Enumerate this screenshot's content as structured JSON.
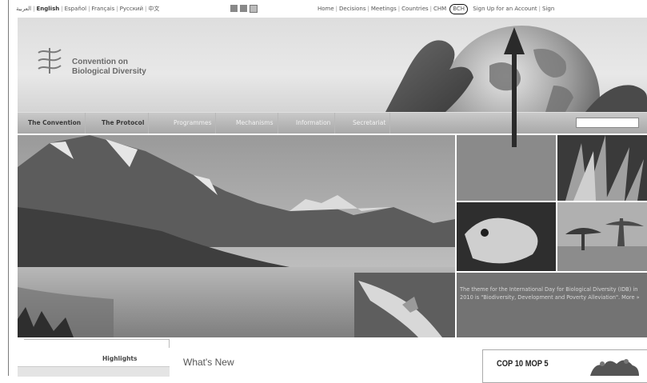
{
  "top_bar": {
    "languages": [
      {
        "label": "العربية",
        "bold": false
      },
      {
        "label": "English",
        "bold": true
      },
      {
        "label": "Español",
        "bold": false
      },
      {
        "label": "Français",
        "bold": false
      },
      {
        "label": "Русский",
        "bold": false
      },
      {
        "label": "中文",
        "bold": false
      }
    ],
    "icons": [
      "print-icon",
      "bookmark-icon",
      "rss-icon"
    ],
    "links": [
      "Home",
      "Decisions",
      "Meetings",
      "Countries",
      "CHM",
      "BCH",
      "Sign Up for an Account",
      "Sign"
    ],
    "highlighted_link": "BCH"
  },
  "logo": {
    "line1": "Convention on",
    "line2": "Biological Diversity"
  },
  "nav": {
    "items": [
      {
        "label": "The Convention",
        "strong": true
      },
      {
        "label": "The Protocol",
        "strong": true
      },
      {
        "label": "Programmes",
        "strong": false
      },
      {
        "label": "Mechanisms",
        "strong": false
      },
      {
        "label": "Information",
        "strong": false
      },
      {
        "label": "Secretariat",
        "strong": false
      }
    ],
    "search_value": ""
  },
  "hero": {
    "theme_text": "The theme for the International Day for Biological Diversity (IDB) in 2010 is \"Biodiversity, Development and Poverty Alleviation\". More »"
  },
  "lower": {
    "highlights_tab": "Highlights",
    "whats_new_title": "What's New",
    "cop_banner": "COP 10 MOP 5"
  },
  "colors": {
    "nav_bar": "#b5b5b5",
    "banner_bg": "#e2e2e2",
    "theme_panel": "#737373",
    "annotation_arrow": "#2a2a2a"
  }
}
